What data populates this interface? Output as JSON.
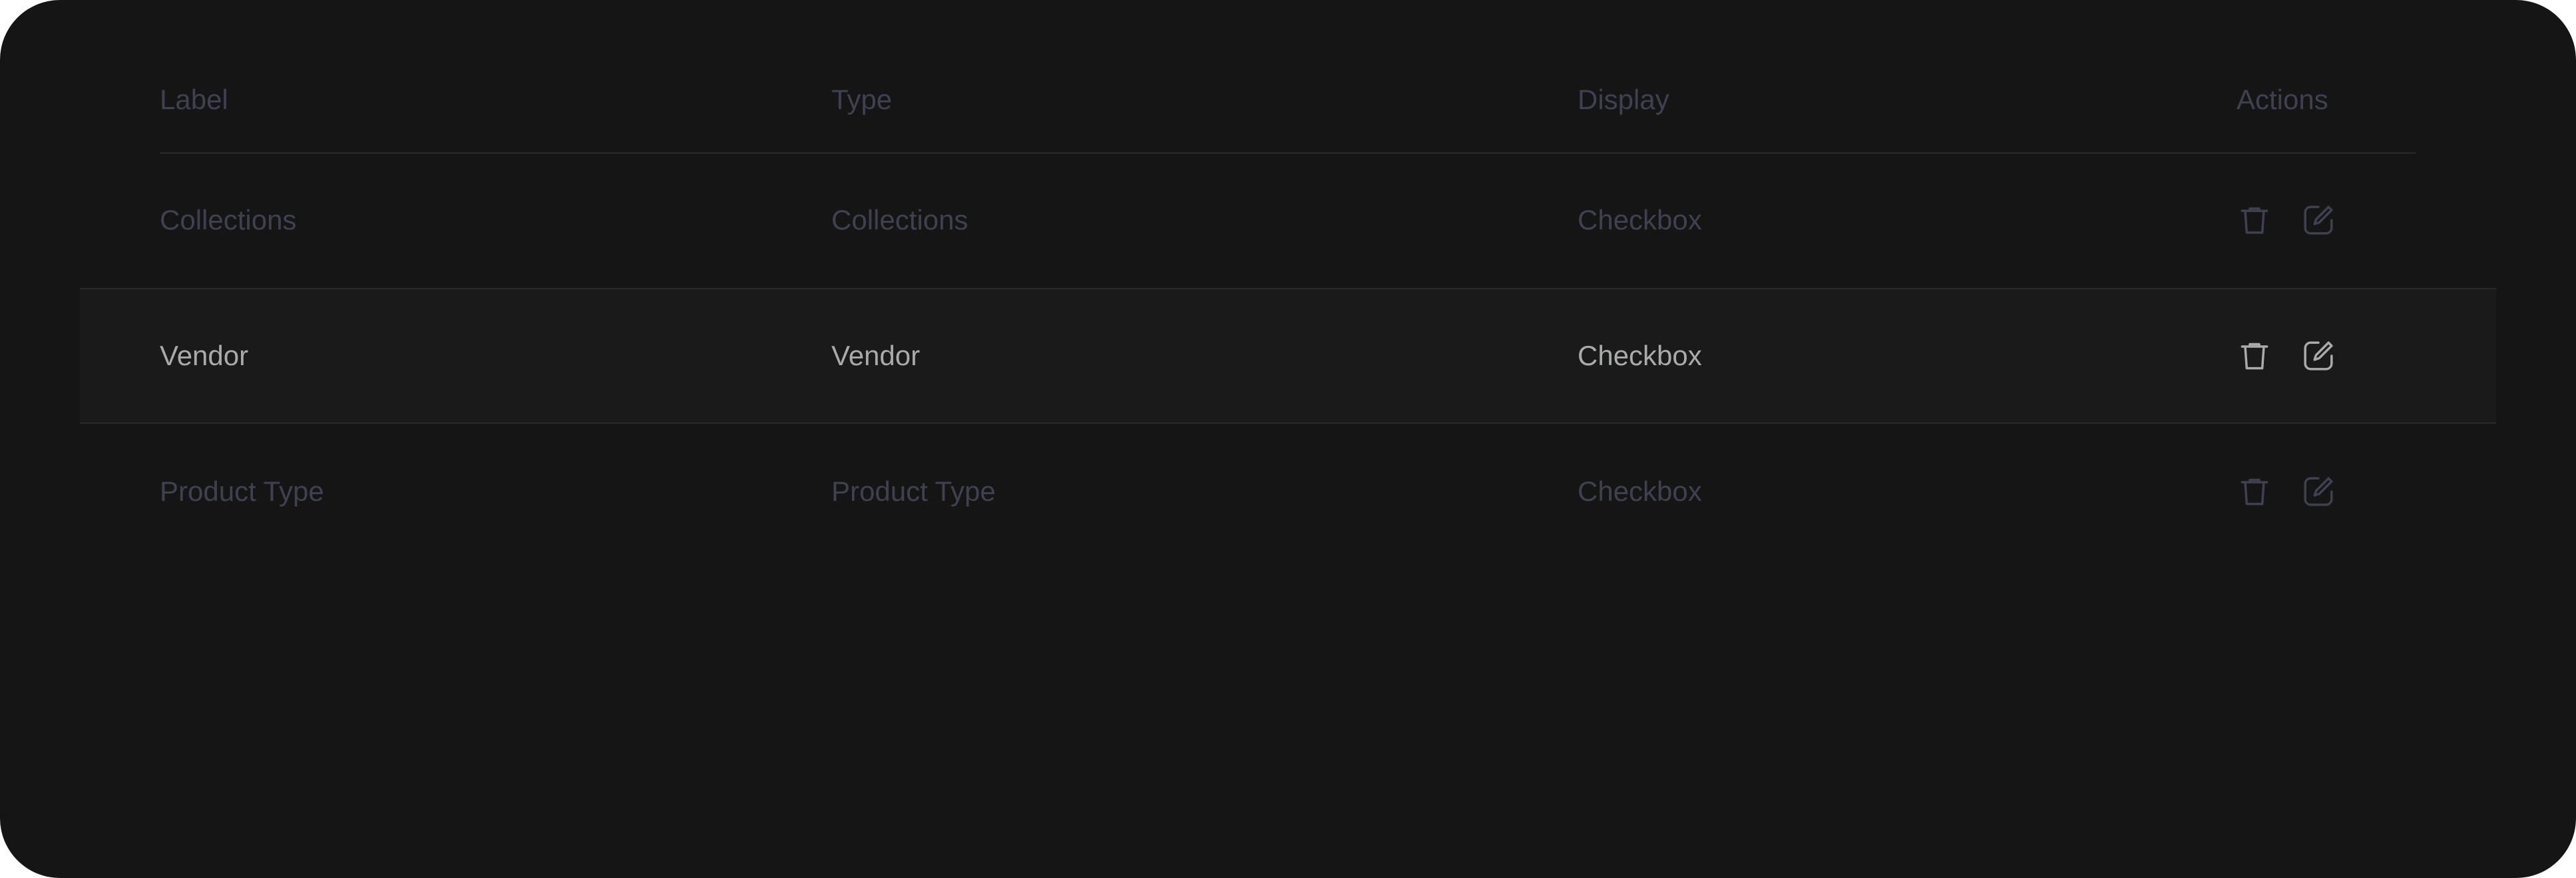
{
  "table": {
    "columns": {
      "label": "Label",
      "type": "Type",
      "display": "Display",
      "actions": "Actions"
    },
    "rows": [
      {
        "label": "Collections",
        "type": "Collections",
        "display": "Checkbox",
        "state": "dimmed"
      },
      {
        "label": "Vendor",
        "type": "Vendor",
        "display": "Checkbox",
        "state": "hover"
      },
      {
        "label": "Product Type",
        "type": "Product Type",
        "display": "Checkbox",
        "state": "dimmed"
      }
    ],
    "action_icons": [
      "trash-icon",
      "edit-icon"
    ]
  },
  "colors": {
    "background": "#151515",
    "dim_text": "#3f4150",
    "active_text": "#a9aaab",
    "divider": "#2a2a2c",
    "hover_row": "#1a1a1a"
  }
}
